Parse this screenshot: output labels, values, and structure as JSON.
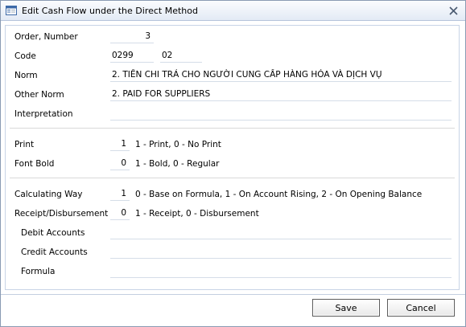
{
  "window": {
    "title": "Edit Cash Flow under the Direct Method",
    "icon": "form-window-icon",
    "close_icon": "close-icon"
  },
  "form": {
    "order_label": "Order, Number",
    "order_value": "3",
    "code_label": "Code",
    "code_value_1": "0299",
    "code_value_2": "02",
    "norm_label": "Norm",
    "norm_value": "2. TIỀN CHI TRẢ CHO NGƯỜI CUNG CẤP HÀNG HÓA VÀ DỊCH VỤ",
    "other_norm_label": "Other Norm",
    "other_norm_value": "2. PAID FOR SUPPLIERS",
    "interpretation_label": "Interpretation",
    "interpretation_value": "",
    "print_label": "Print",
    "print_value": "1",
    "print_hint": "1 - Print, 0 - No Print",
    "font_bold_label": "Font Bold",
    "font_bold_value": "0",
    "font_bold_hint": "1 - Bold, 0 - Regular",
    "calculating_way_label": "Calculating Way",
    "calculating_way_value": "1",
    "calculating_way_hint": "0 - Base on Formula, 1 - On Account Rising, 2 - On Opening Balance",
    "receipt_label": "Receipt/Disbursement",
    "receipt_value": "0",
    "receipt_hint": "1 - Receipt, 0 - Disbursement",
    "debit_label": "Debit Accounts",
    "debit_value": "",
    "credit_label": "Credit Accounts",
    "credit_value": "",
    "formula_label": "Formula",
    "formula_value": ""
  },
  "buttons": {
    "save_label": "Save",
    "cancel_label": "Cancel"
  }
}
